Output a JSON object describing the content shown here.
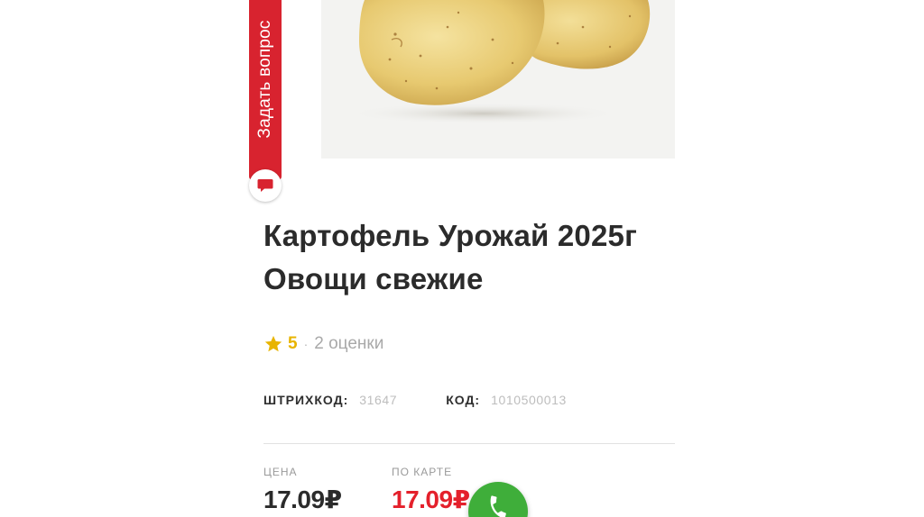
{
  "ask_question": {
    "label": "Задать вопрос",
    "icon": "chat-bubble-icon"
  },
  "product": {
    "image_icon": "potato-photo",
    "title_line1": "Картофель Урожай 2025г",
    "title_line2": "Овощи свежие",
    "rating": {
      "score": "5",
      "separator": "·",
      "reviews": "2 оценки",
      "icon": "star-icon"
    },
    "barcode": {
      "label": "ШТРИХКОД:",
      "value": "31647"
    },
    "code": {
      "label": "КОД:",
      "value": "1010500013"
    },
    "price": {
      "label": "ЦЕНА",
      "value": "17.09₽"
    },
    "card_price": {
      "label": "ПО КАРТЕ",
      "value": "17.09₽"
    }
  },
  "call_button": {
    "icon": "phone-icon"
  },
  "colors": {
    "accent_red": "#d8232f",
    "card_price_red": "#e4202b",
    "rating_yellow": "#e8b400",
    "call_green": "#3fae3a",
    "text_dark": "#2b2b2b"
  }
}
